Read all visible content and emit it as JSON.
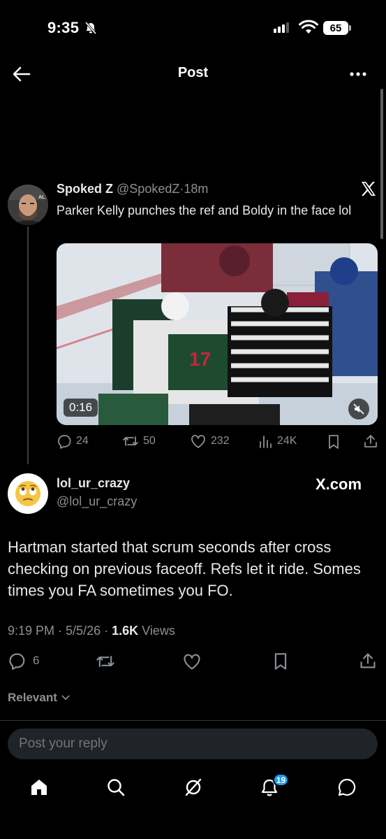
{
  "status_bar": {
    "time": "9:35",
    "battery": "65"
  },
  "header": {
    "title": "Post"
  },
  "quoted_post": {
    "author_name": "Spoked Z",
    "author_handle": "@SpokedZ",
    "separator": "·",
    "time_ago": "18m",
    "text": "Parker Kelly punches the ref and Boldy in the face lol",
    "video_duration": "0:16",
    "replies": "24",
    "reposts": "50",
    "likes": "232",
    "views": "24K"
  },
  "main_post": {
    "author_name": "lol_ur_crazy",
    "author_handle": "@lol_ur_crazy",
    "source_label": "X.com",
    "text": "Hartman started that scrum seconds after cross checking on previous faceoff. Refs let it ride. Somes times you FA sometimes you FO.",
    "time": "9:19 PM",
    "date": "5/5/26",
    "views_count": "1.6K",
    "views_label": "Views",
    "replies": "6"
  },
  "sort": {
    "label": "Relevant"
  },
  "reply_input": {
    "placeholder": "Post your reply"
  },
  "tabbar": {
    "notifications_badge": "19"
  },
  "colors": {
    "accent": "#1d9bf0",
    "background": "#000000",
    "muted": "#8b9096"
  },
  "icons": [
    "back-arrow-icon",
    "more-icon",
    "x-logo-icon",
    "mute-icon",
    "reply-icon",
    "repost-icon",
    "like-icon",
    "views-icon",
    "bookmark-icon",
    "share-icon",
    "home-icon",
    "search-icon",
    "grok-icon",
    "bell-icon",
    "messages-icon"
  ]
}
